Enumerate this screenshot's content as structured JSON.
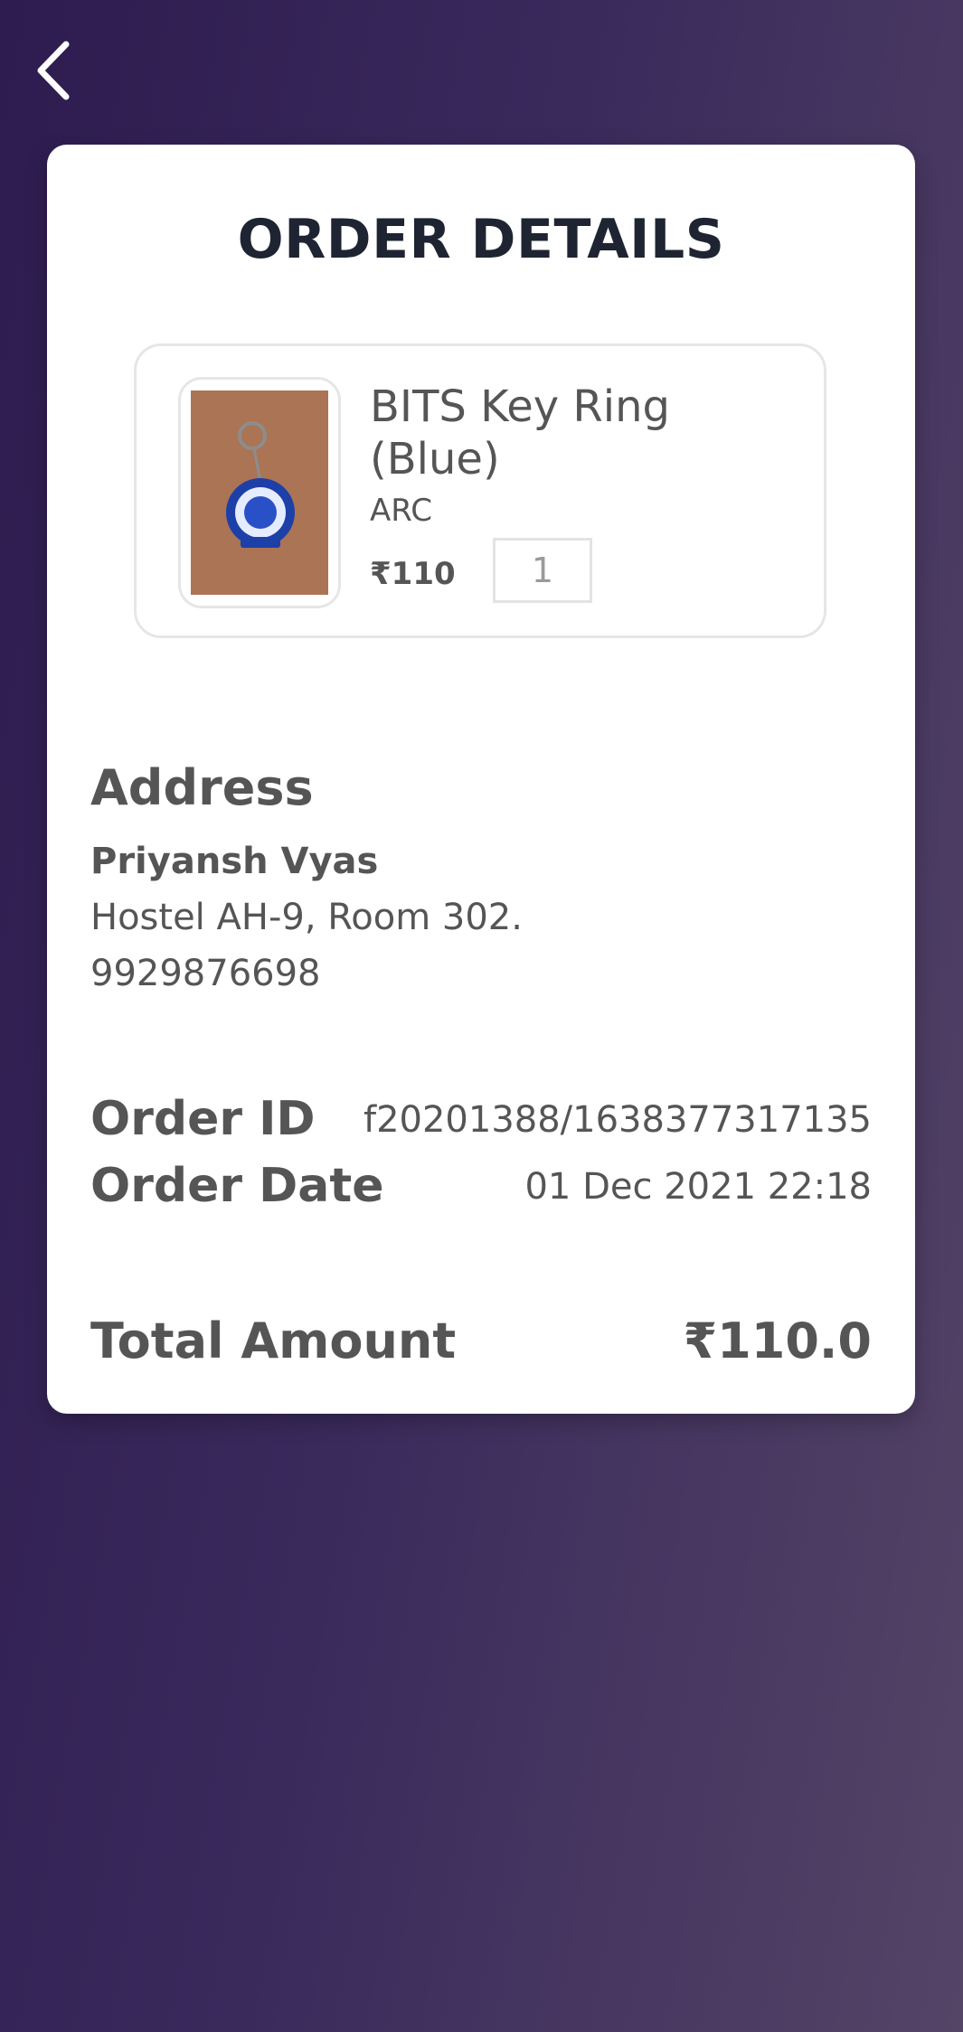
{
  "header": {
    "back_icon": "chevron-left-icon"
  },
  "card": {
    "title": "ORDER DETAILS"
  },
  "product": {
    "name": "BITS Key Ring (Blue)",
    "seller": "ARC",
    "price": "₹110",
    "quantity": "1",
    "image_icon": "keyring-photo"
  },
  "address": {
    "heading": "Address",
    "name": "Priyansh Vyas",
    "line1": "Hostel AH-9, Room 302.",
    "phone": "9929876698"
  },
  "order": {
    "id_label": "Order ID",
    "id_value": "f20201388/1638377317135",
    "date_label": "Order Date",
    "date_value": "01 Dec 2021 22:18"
  },
  "total": {
    "label": "Total Amount",
    "value": "₹110.0"
  },
  "colors": {
    "background_start": "#2e1b4f",
    "background_end": "#544466",
    "card": "#ffffff",
    "title": "#1e2432",
    "text": "#555555"
  }
}
